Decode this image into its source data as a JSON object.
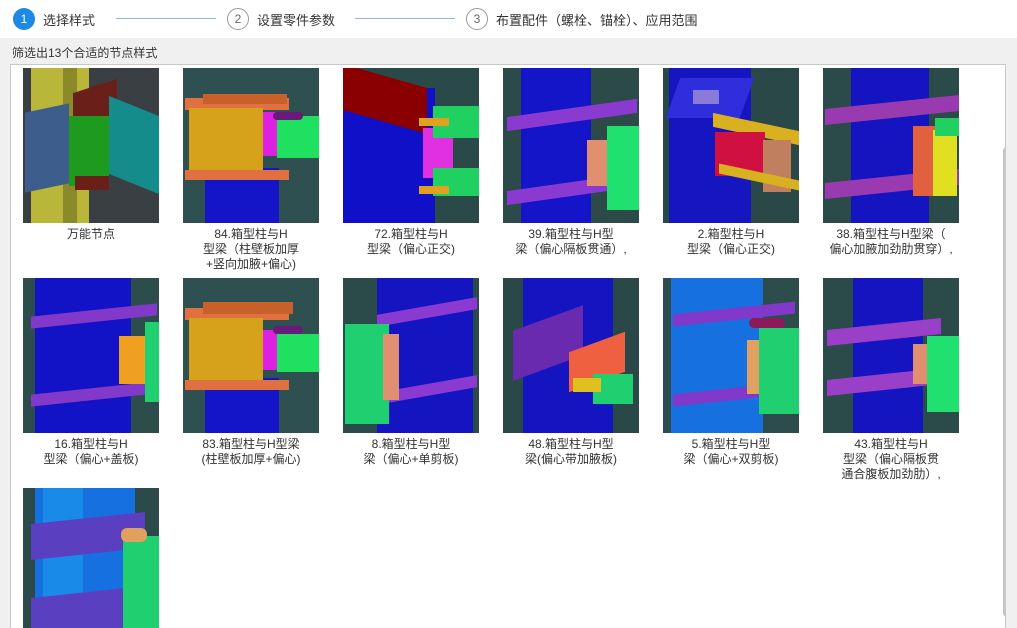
{
  "steps": [
    {
      "num": "1",
      "label": "选择样式"
    },
    {
      "num": "2",
      "label": "设置零件参数"
    },
    {
      "num": "3",
      "label": "布置配件（螺栓、锚栓）、应用范围"
    }
  ],
  "filter_text": "筛选出13个合适的节点样式",
  "cards": [
    {
      "lines": [
        "万能节点"
      ]
    },
    {
      "lines": [
        "84.箱型柱与H",
        "型梁（柱壁板加厚",
        "+竖向加腋+偏心)"
      ]
    },
    {
      "lines": [
        "72.箱型柱与H",
        "型梁（偏心正交)"
      ]
    },
    {
      "lines": [
        "39.箱型柱与H型",
        "梁（偏心隔板贯通）,"
      ]
    },
    {
      "lines": [
        "2.箱型柱与H",
        "型梁（偏心正交)"
      ]
    },
    {
      "lines": [
        "38.箱型柱与H型梁（",
        "偏心加腋加劲肋贯穿）,"
      ]
    },
    {
      "lines": [
        "16.箱型柱与H",
        "型梁（偏心+盖板)"
      ]
    },
    {
      "lines": [
        "83.箱型柱与H型梁",
        "(柱壁板加厚+偏心)"
      ]
    },
    {
      "lines": [
        "8.箱型柱与H型",
        "梁（偏心+单剪板)"
      ]
    },
    {
      "lines": [
        "48.箱型柱与H型",
        "梁(偏心带加腋板)"
      ]
    },
    {
      "lines": [
        "5.箱型柱与H型",
        "梁（偏心+双剪板)"
      ]
    },
    {
      "lines": [
        "43.箱型柱与H",
        "型梁（偏心隔板贯",
        "通合腹板加劲肋）,"
      ]
    },
    {
      "lines": []
    }
  ],
  "colors": {
    "accent": "#1e88e5",
    "step_line": "#8fb5de"
  }
}
